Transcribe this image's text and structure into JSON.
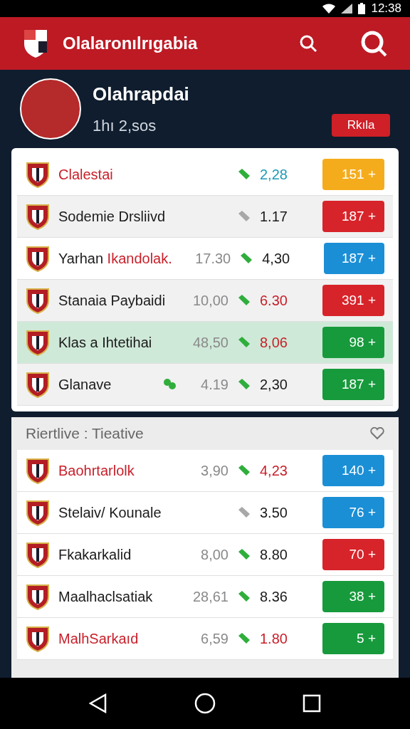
{
  "status_bar": {
    "time": "12:38"
  },
  "app_bar": {
    "title": "Olalaronılrıgabia"
  },
  "profile": {
    "name": "Olahrapdai",
    "subtitle": "1hı 2,sos",
    "button": "Rkıla"
  },
  "top_list": [
    {
      "name": [
        {
          "text": "Clalestai",
          "color": "#c8202a"
        }
      ],
      "trend": {
        "kind": "up"
      },
      "odds": {
        "text": "2,28",
        "color": "#1e9bb5"
      },
      "pick": "151 +",
      "color": "#f5ac1c",
      "selected": false,
      "extra_icon": false
    },
    {
      "name": [
        {
          "text": "Sodemie Drsliivd",
          "color": "#1a1a1a"
        }
      ],
      "trend": {
        "kind": "flat"
      },
      "odds": {
        "text": "1.17",
        "color": "#1a1a1a"
      },
      "pick": "187 +",
      "color": "#d7242a",
      "selected": false,
      "extra_icon": false
    },
    {
      "name": [
        {
          "text": "Yarhan",
          "color": "#1a1a1a"
        },
        {
          "text": "Ikandolak.",
          "color": "#c8202a"
        }
      ],
      "value": "17.30",
      "trend": {
        "kind": "up"
      },
      "odds": {
        "text": "4,30",
        "color": "#1a1a1a"
      },
      "pick": "187 +",
      "color": "#1b8fd6",
      "selected": false,
      "extra_icon": false
    },
    {
      "name": [
        {
          "text": "Stanaia Paybaidi",
          "color": "#1a1a1a"
        }
      ],
      "value": "10,00",
      "trend": {
        "kind": "up"
      },
      "odds": {
        "text": "6.30",
        "color": "#c8202a"
      },
      "pick": "391 +",
      "color": "#d7242a",
      "selected": false,
      "extra_icon": false
    },
    {
      "name": [
        {
          "text": "Klas a Ihtetihai",
          "color": "#1a1a1a"
        }
      ],
      "value": "48,50",
      "trend": {
        "kind": "up"
      },
      "odds": {
        "text": "8,06",
        "color": "#c8202a"
      },
      "pick": "98 +",
      "color": "#179a3c",
      "selected": true,
      "extra_icon": false
    },
    {
      "name": [
        {
          "text": "Glanave",
          "color": "#1a1a1a"
        }
      ],
      "value": "4.19",
      "trend": {
        "kind": "up"
      },
      "odds": {
        "text": "2,30",
        "color": "#1a1a1a"
      },
      "pick": "187 +",
      "color": "#179a3c",
      "selected": false,
      "extra_icon": true
    }
  ],
  "section": {
    "title": "Riertlive : Tieative"
  },
  "bottom_list": [
    {
      "name": [
        {
          "text": "Baohrtarlolk",
          "color": "#c8202a"
        }
      ],
      "value": "3,90",
      "trend": {
        "kind": "up"
      },
      "odds": {
        "text": "4,23",
        "color": "#c8202a"
      },
      "pick": "140 +",
      "color": "#1b8fd6",
      "selected": false,
      "extra_icon": false
    },
    {
      "name": [
        {
          "text": "Stelaiv/  Kounale",
          "color": "#1a1a1a"
        }
      ],
      "trend": {
        "kind": "flat"
      },
      "odds": {
        "text": "3.50",
        "color": "#1a1a1a"
      },
      "pick": "76 +",
      "color": "#1b8fd6",
      "selected": false,
      "extra_icon": false
    },
    {
      "name": [
        {
          "text": "Fkakarkalid",
          "color": "#1a1a1a"
        }
      ],
      "value": "8,00",
      "trend": {
        "kind": "up"
      },
      "odds": {
        "text": "8.80",
        "color": "#1a1a1a"
      },
      "pick": "70 +",
      "color": "#d7242a",
      "selected": false,
      "extra_icon": false
    },
    {
      "name": [
        {
          "text": "Maalhaclsatiak",
          "color": "#1a1a1a"
        }
      ],
      "value": "28,61",
      "trend": {
        "kind": "up"
      },
      "odds": {
        "text": "8.36",
        "color": "#1a1a1a"
      },
      "pick": "38 +",
      "color": "#179a3c",
      "selected": false,
      "extra_icon": false
    },
    {
      "name": [
        {
          "text": "MalhSarkaıd",
          "color": "#c8202a"
        }
      ],
      "value": "6,59",
      "trend": {
        "kind": "up"
      },
      "odds": {
        "text": "1.80",
        "color": "#c8202a"
      },
      "pick": "5 +",
      "color": "#179a3c",
      "selected": false,
      "extra_icon": false
    }
  ]
}
